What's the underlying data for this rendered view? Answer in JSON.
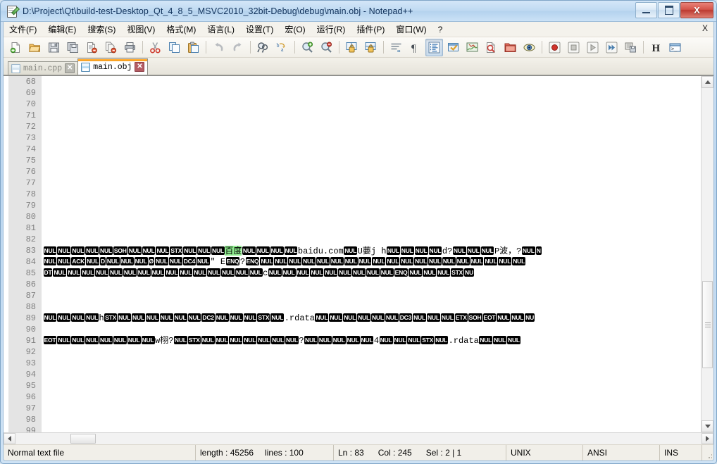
{
  "window": {
    "title": "D:\\Project\\Qt\\build-test-Desktop_Qt_4_8_5_MSVC2010_32bit-Debug\\debug\\main.obj - Notepad++",
    "icon": "notepad-document-icon",
    "minimize_label": "",
    "maximize_label": "",
    "close_label": "X"
  },
  "menu": {
    "items": [
      {
        "label": "文件(F)",
        "name": "menu-file"
      },
      {
        "label": "编辑(E)",
        "name": "menu-edit"
      },
      {
        "label": "搜索(S)",
        "name": "menu-search"
      },
      {
        "label": "视图(V)",
        "name": "menu-view"
      },
      {
        "label": "格式(M)",
        "name": "menu-format"
      },
      {
        "label": "语言(L)",
        "name": "menu-language"
      },
      {
        "label": "设置(T)",
        "name": "menu-settings"
      },
      {
        "label": "宏(O)",
        "name": "menu-macro"
      },
      {
        "label": "运行(R)",
        "name": "menu-run"
      },
      {
        "label": "插件(P)",
        "name": "menu-plugins"
      },
      {
        "label": "窗口(W)",
        "name": "menu-window"
      },
      {
        "label": "?",
        "name": "menu-help"
      }
    ],
    "close_doc_label": "X"
  },
  "toolbar": {
    "buttons": [
      {
        "name": "new-file-icon",
        "title": "New"
      },
      {
        "name": "open-file-icon",
        "title": "Open"
      },
      {
        "name": "save-icon",
        "title": "Save"
      },
      {
        "name": "save-all-icon",
        "title": "Save All"
      },
      {
        "name": "close-file-icon",
        "title": "Close"
      },
      {
        "name": "close-all-icon",
        "title": "Close All"
      },
      {
        "name": "print-icon",
        "title": "Print"
      },
      {
        "name": "cut-icon",
        "title": "Cut"
      },
      {
        "name": "copy-icon",
        "title": "Copy"
      },
      {
        "name": "paste-icon",
        "title": "Paste"
      },
      {
        "name": "undo-icon",
        "title": "Undo"
      },
      {
        "name": "redo-icon",
        "title": "Redo"
      },
      {
        "name": "find-icon",
        "title": "Find"
      },
      {
        "name": "replace-icon",
        "title": "Replace"
      },
      {
        "name": "zoom-in-icon",
        "title": "Zoom In"
      },
      {
        "name": "zoom-out-icon",
        "title": "Zoom Out"
      },
      {
        "name": "sync-vertical-scroll-icon",
        "title": "Synchronize Vertical Scrolling"
      },
      {
        "name": "sync-horizontal-scroll-icon",
        "title": "Synchronize Horizontal Scrolling"
      },
      {
        "name": "word-wrap-icon",
        "title": "Word wrap"
      },
      {
        "name": "show-all-characters-icon",
        "title": "Show All Characters"
      },
      {
        "name": "indent-guide-icon",
        "title": "Show Indent Guide",
        "pressed": true
      },
      {
        "name": "user-define-dialog-icon",
        "title": "User Defined Dialogue"
      },
      {
        "name": "document-map-icon",
        "title": "Document Map"
      },
      {
        "name": "function-list-icon",
        "title": "Function List"
      },
      {
        "name": "folder-as-workspace-icon",
        "title": "Folder as Workspace"
      },
      {
        "name": "monitoring-icon",
        "title": "Monitoring"
      },
      {
        "name": "record-macro-icon",
        "title": "Start Recording"
      },
      {
        "name": "stop-macro-icon",
        "title": "Stop Recording"
      },
      {
        "name": "play-macro-icon",
        "title": "Playback"
      },
      {
        "name": "run-macro-multiple-icon",
        "title": "Run a Macro Multiple Times"
      },
      {
        "name": "save-macro-icon",
        "title": "Save Currently Recorded Macro"
      },
      {
        "name": "hash-icon",
        "title": "H"
      },
      {
        "name": "run-console-icon",
        "title": "Run"
      }
    ]
  },
  "tabs": [
    {
      "label": "main.cpp",
      "active": false,
      "name": "tab-main-cpp",
      "close": "✕"
    },
    {
      "label": "main.obj",
      "active": true,
      "name": "tab-main-obj",
      "close": "✕"
    }
  ],
  "editor": {
    "first_line_number": 68,
    "line_numbers": [
      68,
      69,
      70,
      71,
      72,
      73,
      74,
      75,
      76,
      77,
      78,
      79,
      80,
      81,
      82,
      83,
      84,
      85,
      86,
      87,
      88,
      89,
      90,
      91,
      92,
      93,
      94,
      95,
      96,
      97,
      98,
      99
    ],
    "highlight_color": "#90ee90",
    "lines": [
      {
        "number": 68,
        "tokens": []
      },
      {
        "number": 69,
        "tokens": []
      },
      {
        "number": 70,
        "tokens": []
      },
      {
        "number": 71,
        "tokens": []
      },
      {
        "number": 72,
        "tokens": []
      },
      {
        "number": 73,
        "tokens": []
      },
      {
        "number": 74,
        "tokens": []
      },
      {
        "number": 75,
        "tokens": []
      },
      {
        "number": 76,
        "tokens": []
      },
      {
        "number": 77,
        "tokens": []
      },
      {
        "number": 78,
        "tokens": []
      },
      {
        "number": 79,
        "tokens": []
      },
      {
        "number": 80,
        "tokens": []
      },
      {
        "number": 81,
        "tokens": []
      },
      {
        "number": 82,
        "tokens": []
      },
      {
        "number": 83,
        "tokens": [
          {
            "t": "c",
            "v": "NUL"
          },
          {
            "t": "c",
            "v": "NUL"
          },
          {
            "t": "c",
            "v": "NUL"
          },
          {
            "t": "c",
            "v": "NUL"
          },
          {
            "t": "c",
            "v": "NUL"
          },
          {
            "t": "c",
            "v": "SOH"
          },
          {
            "t": "c",
            "v": "NUL"
          },
          {
            "t": "c",
            "v": "NUL"
          },
          {
            "t": "c",
            "v": "NUL"
          },
          {
            "t": "c",
            "v": "STX"
          },
          {
            "t": "c",
            "v": "NUL"
          },
          {
            "t": "c",
            "v": "NUL"
          },
          {
            "t": "c",
            "v": "NUL"
          },
          {
            "t": "h",
            "v": "百度"
          },
          {
            "t": "c",
            "v": "NUL"
          },
          {
            "t": "c",
            "v": "NUL"
          },
          {
            "t": "c",
            "v": "NUL"
          },
          {
            "t": "c",
            "v": "NUL"
          },
          {
            "t": "p",
            "v": "baidu.com"
          },
          {
            "t": "c",
            "v": "NUL"
          },
          {
            "t": "p",
            "v": "U葽j  h"
          },
          {
            "t": "c",
            "v": "NUL"
          },
          {
            "t": "c",
            "v": "NUL"
          },
          {
            "t": "c",
            "v": "NUL"
          },
          {
            "t": "c",
            "v": "NUL"
          },
          {
            "t": "p",
            "v": "d?"
          },
          {
            "t": "c",
            "v": "NUL"
          },
          {
            "t": "c",
            "v": "NUL"
          },
          {
            "t": "c",
            "v": "NUL"
          },
          {
            "t": "p",
            "v": "P波，?"
          },
          {
            "t": "c",
            "v": "NUL"
          },
          {
            "t": "c",
            "v": "N"
          }
        ]
      },
      {
        "number": 84,
        "tokens": [
          {
            "t": "c",
            "v": "NUL"
          },
          {
            "t": "c",
            "v": "NUL"
          },
          {
            "t": "c",
            "v": "ACK"
          },
          {
            "t": "c",
            "v": "NUL"
          },
          {
            "t": "c",
            "v": "D"
          },
          {
            "t": "c",
            "v": "NUL"
          },
          {
            "t": "c",
            "v": "NUL"
          },
          {
            "t": "c",
            "v": "NUL"
          },
          {
            "t": "c",
            "v": "Ø"
          },
          {
            "t": "c",
            "v": "NUL"
          },
          {
            "t": "c",
            "v": "NUL"
          },
          {
            "t": "c",
            "v": "DC4"
          },
          {
            "t": "c",
            "v": "NUL"
          },
          {
            "t": "p",
            "v": "\" E"
          },
          {
            "t": "c",
            "v": "ENQ"
          },
          {
            "t": "p",
            "v": "?"
          },
          {
            "t": "c",
            "v": "ENQ"
          },
          {
            "t": "c",
            "v": "NUL"
          },
          {
            "t": "c",
            "v": "NUL"
          },
          {
            "t": "c",
            "v": "NUL"
          },
          {
            "t": "c",
            "v": "NUL"
          },
          {
            "t": "c",
            "v": "NUL"
          },
          {
            "t": "c",
            "v": "NUL"
          },
          {
            "t": "c",
            "v": "NUL"
          },
          {
            "t": "c",
            "v": "NUL"
          },
          {
            "t": "c",
            "v": "NUL"
          },
          {
            "t": "c",
            "v": "NUL"
          },
          {
            "t": "c",
            "v": "NUL"
          },
          {
            "t": "c",
            "v": "NUL"
          },
          {
            "t": "c",
            "v": "NUL"
          },
          {
            "t": "c",
            "v": "NUL"
          },
          {
            "t": "c",
            "v": "NUL"
          },
          {
            "t": "c",
            "v": "NUL"
          },
          {
            "t": "c",
            "v": "NUL"
          },
          {
            "t": "c",
            "v": "NUL"
          },
          {
            "t": "c",
            "v": "NUL"
          }
        ]
      },
      {
        "number": 85,
        "tokens": [
          {
            "t": "c",
            "v": "DT"
          },
          {
            "t": "c",
            "v": "NUL"
          },
          {
            "t": "c",
            "v": "NUL"
          },
          {
            "t": "c",
            "v": "NUL"
          },
          {
            "t": "c",
            "v": "NUL"
          },
          {
            "t": "c",
            "v": "NUL"
          },
          {
            "t": "c",
            "v": "NUL"
          },
          {
            "t": "c",
            "v": "NUL"
          },
          {
            "t": "c",
            "v": "NUL"
          },
          {
            "t": "c",
            "v": "NUL"
          },
          {
            "t": "c",
            "v": "NUL"
          },
          {
            "t": "c",
            "v": "NUL"
          },
          {
            "t": "c",
            "v": "NUL"
          },
          {
            "t": "c",
            "v": "NUL"
          },
          {
            "t": "c",
            "v": "NUL"
          },
          {
            "t": "c",
            "v": "NUL"
          },
          {
            "t": "p",
            "v": "c"
          },
          {
            "t": "c",
            "v": "NUL"
          },
          {
            "t": "c",
            "v": "NUL"
          },
          {
            "t": "c",
            "v": "NUL"
          },
          {
            "t": "c",
            "v": "NUL"
          },
          {
            "t": "c",
            "v": "NUL"
          },
          {
            "t": "c",
            "v": "NUL"
          },
          {
            "t": "c",
            "v": "NUL"
          },
          {
            "t": "c",
            "v": "NUL"
          },
          {
            "t": "c",
            "v": "NUL"
          },
          {
            "t": "c",
            "v": "ENQ"
          },
          {
            "t": "c",
            "v": "NUL"
          },
          {
            "t": "c",
            "v": "NUL"
          },
          {
            "t": "c",
            "v": "NUL"
          },
          {
            "t": "c",
            "v": "STX"
          },
          {
            "t": "c",
            "v": "NU"
          }
        ]
      },
      {
        "number": 86,
        "tokens": []
      },
      {
        "number": 87,
        "tokens": []
      },
      {
        "number": 88,
        "tokens": []
      },
      {
        "number": 89,
        "tokens": [
          {
            "t": "c",
            "v": "NUL"
          },
          {
            "t": "c",
            "v": "NUL"
          },
          {
            "t": "c",
            "v": "NUL"
          },
          {
            "t": "c",
            "v": "NUL"
          },
          {
            "t": "p",
            "v": "h"
          },
          {
            "t": "c",
            "v": "STX"
          },
          {
            "t": "c",
            "v": "NUL"
          },
          {
            "t": "c",
            "v": "NUL"
          },
          {
            "t": "c",
            "v": "NUL"
          },
          {
            "t": "c",
            "v": "NUL"
          },
          {
            "t": "c",
            "v": "NUL"
          },
          {
            "t": "c",
            "v": "NUL"
          },
          {
            "t": "c",
            "v": "DC2"
          },
          {
            "t": "c",
            "v": "NUL"
          },
          {
            "t": "c",
            "v": "NUL"
          },
          {
            "t": "c",
            "v": "NUL"
          },
          {
            "t": "c",
            "v": "STX"
          },
          {
            "t": "c",
            "v": "NUL"
          },
          {
            "t": "p",
            "v": ".rdata"
          },
          {
            "t": "c",
            "v": "NUL"
          },
          {
            "t": "c",
            "v": "NUL"
          },
          {
            "t": "c",
            "v": "NUL"
          },
          {
            "t": "c",
            "v": "NUL"
          },
          {
            "t": "c",
            "v": "NUL"
          },
          {
            "t": "c",
            "v": "NUL"
          },
          {
            "t": "c",
            "v": "DC3"
          },
          {
            "t": "c",
            "v": "NUL"
          },
          {
            "t": "c",
            "v": "NUL"
          },
          {
            "t": "c",
            "v": "NUL"
          },
          {
            "t": "c",
            "v": "ETX"
          },
          {
            "t": "c",
            "v": "SOH"
          },
          {
            "t": "c",
            "v": "EOT"
          },
          {
            "t": "c",
            "v": "NUL"
          },
          {
            "t": "c",
            "v": "NUL"
          },
          {
            "t": "c",
            "v": "NU"
          }
        ]
      },
      {
        "number": 90,
        "tokens": []
      },
      {
        "number": 91,
        "tokens": [
          {
            "t": "c",
            "v": "EOT"
          },
          {
            "t": "c",
            "v": "NUL"
          },
          {
            "t": "c",
            "v": "NUL"
          },
          {
            "t": "c",
            "v": "NUL"
          },
          {
            "t": "c",
            "v": "NUL"
          },
          {
            "t": "c",
            "v": "NUL"
          },
          {
            "t": "c",
            "v": "NUL"
          },
          {
            "t": "c",
            "v": "NUL"
          },
          {
            "t": "p",
            "v": "w栩?"
          },
          {
            "t": "c",
            "v": "NUL"
          },
          {
            "t": "c",
            "v": "STX"
          },
          {
            "t": "c",
            "v": "NUL"
          },
          {
            "t": "c",
            "v": "NUL"
          },
          {
            "t": "c",
            "v": "NUL"
          },
          {
            "t": "c",
            "v": "NUL"
          },
          {
            "t": "c",
            "v": "NUL"
          },
          {
            "t": "c",
            "v": "NUL"
          },
          {
            "t": "c",
            "v": "NUL"
          },
          {
            "t": "p",
            "v": "?"
          },
          {
            "t": "c",
            "v": "NUL"
          },
          {
            "t": "c",
            "v": "NUL"
          },
          {
            "t": "c",
            "v": "NUL"
          },
          {
            "t": "c",
            "v": "NUL"
          },
          {
            "t": "c",
            "v": "NUL"
          },
          {
            "t": "p",
            "v": "4"
          },
          {
            "t": "c",
            "v": "NUL"
          },
          {
            "t": "c",
            "v": "NUL"
          },
          {
            "t": "c",
            "v": "NUL"
          },
          {
            "t": "c",
            "v": "STX"
          },
          {
            "t": "c",
            "v": "NUL"
          },
          {
            "t": "p",
            "v": ".rdata"
          },
          {
            "t": "c",
            "v": "NUL"
          },
          {
            "t": "c",
            "v": "NUL"
          },
          {
            "t": "c",
            "v": "NUL"
          }
        ]
      },
      {
        "number": 92,
        "tokens": []
      },
      {
        "number": 93,
        "tokens": []
      },
      {
        "number": 94,
        "tokens": []
      },
      {
        "number": 95,
        "tokens": []
      },
      {
        "number": 96,
        "tokens": []
      },
      {
        "number": 97,
        "tokens": []
      },
      {
        "number": 98,
        "tokens": []
      },
      {
        "number": 99,
        "tokens": []
      }
    ]
  },
  "statusbar": {
    "file_type": "Normal text file",
    "length": "length : 45256",
    "lines": "lines : 100",
    "ln": "Ln : 83",
    "col": "Col : 245",
    "sel": "Sel : 2 | 1",
    "eol": "UNIX",
    "encoding": "ANSI",
    "insert_mode": "INS"
  }
}
